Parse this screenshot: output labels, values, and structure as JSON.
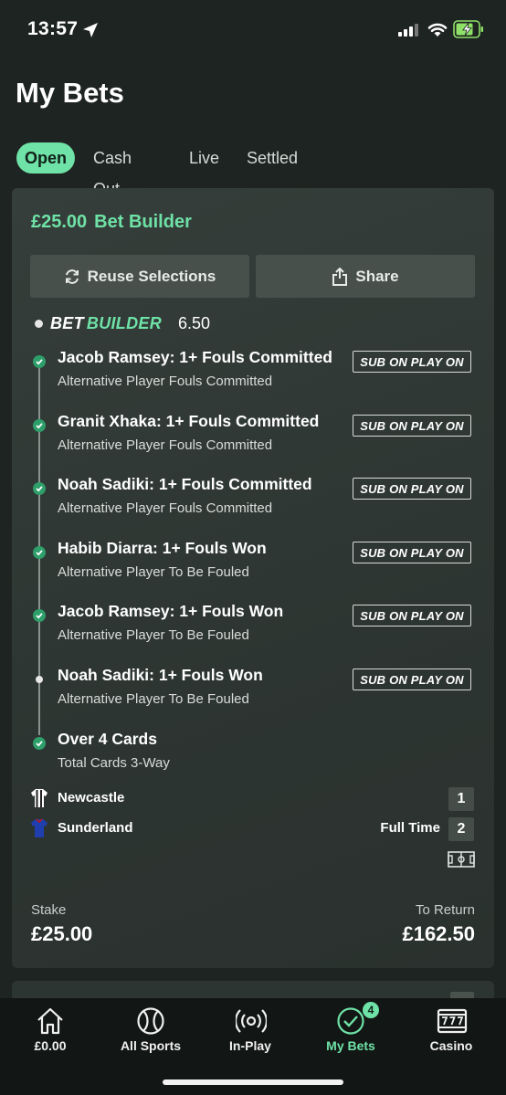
{
  "status": {
    "time": "13:57"
  },
  "page": {
    "title": "My Bets"
  },
  "tabs": [
    "Open",
    "Cash Out",
    "Live",
    "Settled"
  ],
  "bet": {
    "stake_header": "£25.00",
    "bet_type": "Bet Builder",
    "reuse_label": "Reuse Selections",
    "share_label": "Share",
    "builder_logo_white": "BET",
    "builder_logo_green": "BUILDER",
    "odds": "6.50",
    "legs": [
      {
        "title": "Jacob Ramsey: 1+ Fouls Committed",
        "market": "Alternative Player Fouls Committed",
        "badge": "SUB ON PLAY ON",
        "status": "won"
      },
      {
        "title": "Granit Xhaka: 1+ Fouls Committed",
        "market": "Alternative Player Fouls Committed",
        "badge": "SUB ON PLAY ON",
        "status": "won"
      },
      {
        "title": "Noah Sadiki: 1+ Fouls Committed",
        "market": "Alternative Player Fouls Committed",
        "badge": "SUB ON PLAY ON",
        "status": "won"
      },
      {
        "title": "Habib Diarra: 1+ Fouls Won",
        "market": "Alternative Player To Be Fouled",
        "badge": "SUB ON PLAY ON",
        "status": "won"
      },
      {
        "title": "Jacob Ramsey: 1+ Fouls Won",
        "market": "Alternative Player To Be Fouled",
        "badge": "SUB ON PLAY ON",
        "status": "won"
      },
      {
        "title": "Noah Sadiki: 1+ Fouls Won",
        "market": "Alternative Player To Be Fouled",
        "badge": "SUB ON PLAY ON",
        "status": "open"
      },
      {
        "title": "Over 4 Cards",
        "market": "Total Cards 3-Way",
        "badge": "",
        "status": "won"
      }
    ],
    "match": {
      "home": {
        "name": "Newcastle",
        "score": "1"
      },
      "away": {
        "name": "Sunderland",
        "score": "2"
      },
      "status": "Full Time"
    },
    "stake_label": "Stake",
    "stake_value": "£25.00",
    "return_label": "To Return",
    "return_value": "£162.50"
  },
  "nav": {
    "items": [
      {
        "label": "£0.00",
        "icon": "home-icon"
      },
      {
        "label": "All Sports",
        "icon": "tennis-ball-icon"
      },
      {
        "label": "In-Play",
        "icon": "broadcast-icon"
      },
      {
        "label": "My Bets",
        "icon": "check-circle-icon",
        "badge": "4"
      },
      {
        "label": "Casino",
        "icon": "slot-machine-icon"
      }
    ]
  },
  "colors": {
    "accent": "#6fe2a7",
    "background": "#1e2421",
    "card": "#2f3734",
    "button": "#48504c"
  }
}
